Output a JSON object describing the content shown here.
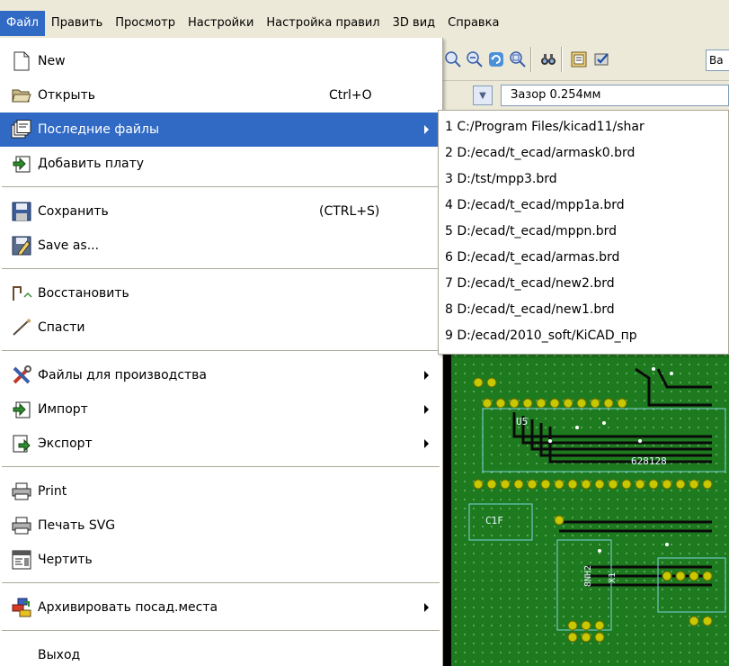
{
  "menubar": {
    "items": [
      {
        "label": "Файл",
        "active": true
      },
      {
        "label": "Править"
      },
      {
        "label": "Просмотр"
      },
      {
        "label": "Настройки"
      },
      {
        "label": "Настройка правил"
      },
      {
        "label": "3D вид"
      },
      {
        "label": "Справка"
      }
    ]
  },
  "toolbar": {
    "combo_fragment": "Ba",
    "clearance_label": "Зазор 0.254мм"
  },
  "file_menu": {
    "items": [
      {
        "label": "New",
        "icon": "new-document-icon"
      },
      {
        "label": "Открыть",
        "shortcut": "Ctrl+O",
        "icon": "open-folder-icon"
      },
      {
        "label": "Последние файлы",
        "has_submenu": true,
        "highlighted": true,
        "icon": "recent-files-icon"
      },
      {
        "label": "Добавить плату",
        "icon": "append-board-icon"
      },
      {
        "label": "Сохранить",
        "shortcut": "(CTRL+S)",
        "icon": "save-icon"
      },
      {
        "label": "Save as...",
        "icon": "save-as-icon"
      },
      {
        "label": "Восстановить",
        "icon": "revert-icon"
      },
      {
        "label": "Спасти",
        "icon": "rescue-icon"
      },
      {
        "label": "Файлы для производства",
        "has_submenu": true,
        "icon": "fabrication-tools-icon"
      },
      {
        "label": "Импорт",
        "has_submenu": true,
        "icon": "import-icon"
      },
      {
        "label": "Экспорт",
        "has_submenu": true,
        "icon": "export-icon"
      },
      {
        "label": "Print",
        "icon": "printer-icon"
      },
      {
        "label": "Печать SVG",
        "icon": "print-svg-icon"
      },
      {
        "label": "Чертить",
        "icon": "plot-icon"
      },
      {
        "label": "Архивировать посад.места",
        "has_submenu": true,
        "icon": "archive-footprints-icon"
      },
      {
        "label": "Выход",
        "icon": ""
      }
    ]
  },
  "recent_files": {
    "items": [
      "1 C:/Program Files/kicad11/shar",
      "2 D:/ecad/t_ecad/armask0.brd",
      "3 D:/tst/mpp3.brd",
      "4 D:/ecad/t_ecad/mpp1a.brd",
      "5 D:/ecad/t_ecad/mppn.brd",
      "6 D:/ecad/t_ecad/armas.brd",
      "7 D:/ecad/t_ecad/new2.brd",
      "8 D:/ecad/t_ecad/new1.brd",
      "9 D:/ecad/2010_soft/KiCAD_пр"
    ]
  },
  "pcb": {
    "labels": [
      "U5",
      "628128",
      "C1F",
      "8NH2",
      "X1"
    ]
  },
  "colors": {
    "menu_highlight": "#316ac5",
    "menu_background": "#ffffff",
    "chrome": "#ece9d8",
    "pcb_background": "#000000",
    "pcb_board": "#1e7a1e",
    "pcb_pad": "#c8c800"
  }
}
